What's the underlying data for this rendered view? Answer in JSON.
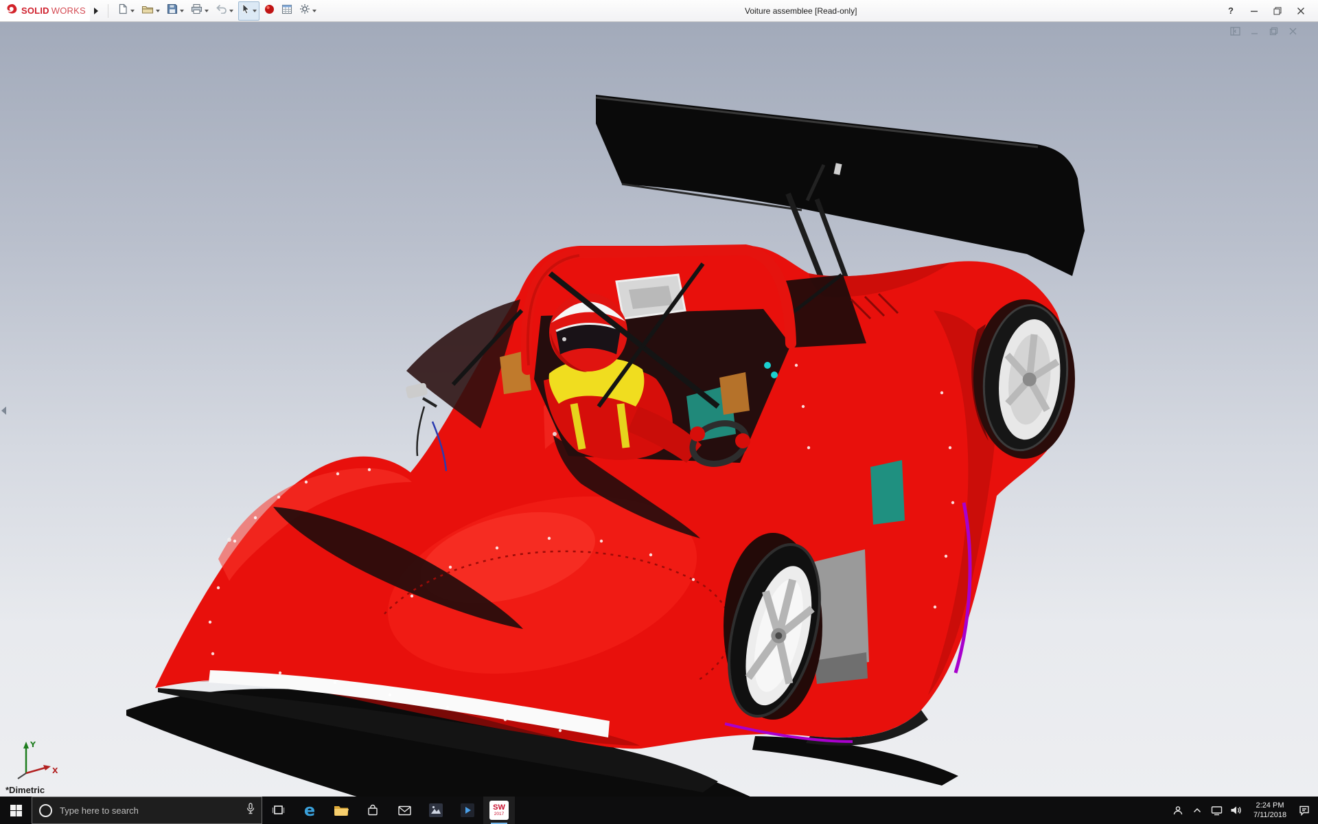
{
  "titlebar": {
    "brand": {
      "solid": "SOLID",
      "works": "WORKS"
    },
    "title": "Voiture assemblee [Read-only]",
    "help_label": "?",
    "tools": [
      "new-document",
      "open",
      "save",
      "print",
      "undo",
      "select-cursor",
      "appearance-sphere",
      "design-table",
      "options-gear"
    ]
  },
  "viewport": {
    "orientation_label": "*Dimetric",
    "triad": {
      "x": "X",
      "y": "Y"
    }
  },
  "model": {
    "body_color": "#e8100c",
    "wing_color": "#0a0a0a",
    "harness_color": "#f0dd1f",
    "seat_color": "#20897a",
    "accent_purple": "#a800cc",
    "rim_color": "#ededed"
  },
  "taskbar": {
    "search": {
      "placeholder": "Type here to search"
    },
    "edge_glyph": "e",
    "solidworks_icon": {
      "line1": "SW",
      "line2": "2017"
    },
    "clock": {
      "time": "2:24 PM",
      "date": "7/11/2018"
    }
  },
  "icons": {
    "list": [
      "ds-swirl-logo",
      "menu-flyout-arrow",
      "new-document-icon",
      "open-icon",
      "save-icon",
      "print-icon",
      "undo-icon",
      "select-cursor-icon",
      "appearance-sphere-icon",
      "design-table-icon",
      "options-gear-icon",
      "help-icon",
      "minimize-icon",
      "restore-icon",
      "close-icon",
      "pane-left-icon",
      "maximize-window-icon",
      "restore-window-icon",
      "close-window-icon",
      "collapse-panel-arrow-icon",
      "orientation-triad-icon",
      "windows-start-icon",
      "cortana-circle-icon",
      "microphone-icon",
      "task-view-icon",
      "edge-icon",
      "file-explorer-icon",
      "store-icon",
      "mail-icon",
      "photos-icon",
      "movies-tv-icon",
      "solidworks-app-icon",
      "people-icon",
      "chevron-up-icon",
      "network-icon",
      "volume-icon",
      "action-center-icon"
    ]
  }
}
